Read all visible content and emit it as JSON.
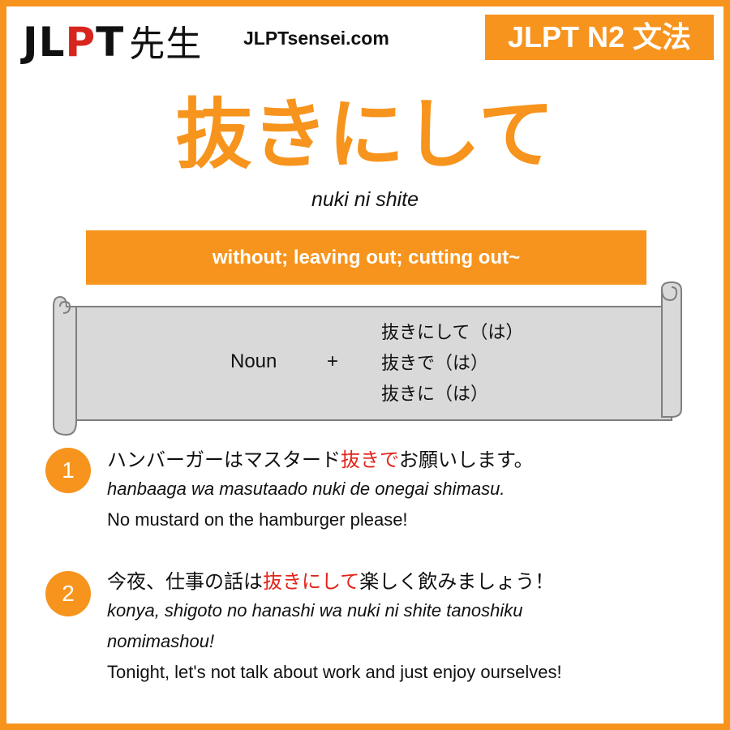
{
  "header": {
    "logo_jlpt": "JLPT",
    "logo_sensei": "先生",
    "site": "JLPTsensei.com",
    "level_badge": "JLPT N2 文法"
  },
  "grammar": {
    "title": "抜きにして",
    "romaji": "nuki ni shite",
    "meaning": "without; leaving out; cutting out~"
  },
  "formation": {
    "noun": "Noun",
    "plus": "+",
    "forms": [
      "抜きにして（は）",
      "抜きで（は）",
      "抜きに（は）"
    ]
  },
  "examples": [
    {
      "number": "1",
      "jp_before": "ハンバーガーはマスタード",
      "jp_highlight": "抜きで",
      "jp_after": "お願いします。",
      "romaji_lines": [
        "hanbaaga wa masutaado nuki de onegai shimasu."
      ],
      "english": "No mustard on the hamburger please!"
    },
    {
      "number": "2",
      "jp_before": "今夜、仕事の話は",
      "jp_highlight": "抜きにして",
      "jp_after": "楽しく飲みましょう！",
      "romaji_lines": [
        "konya, shigoto no hanashi wa nuki ni shite tanoshiku",
        "nomimashou!"
      ],
      "english": "Tonight, let's not talk about work and just enjoy ourselves!"
    }
  ],
  "colors": {
    "accent": "#f7941d",
    "highlight": "#e2231a",
    "scroll_fill": "#d9d9d9",
    "scroll_stroke": "#7f7f7f"
  }
}
